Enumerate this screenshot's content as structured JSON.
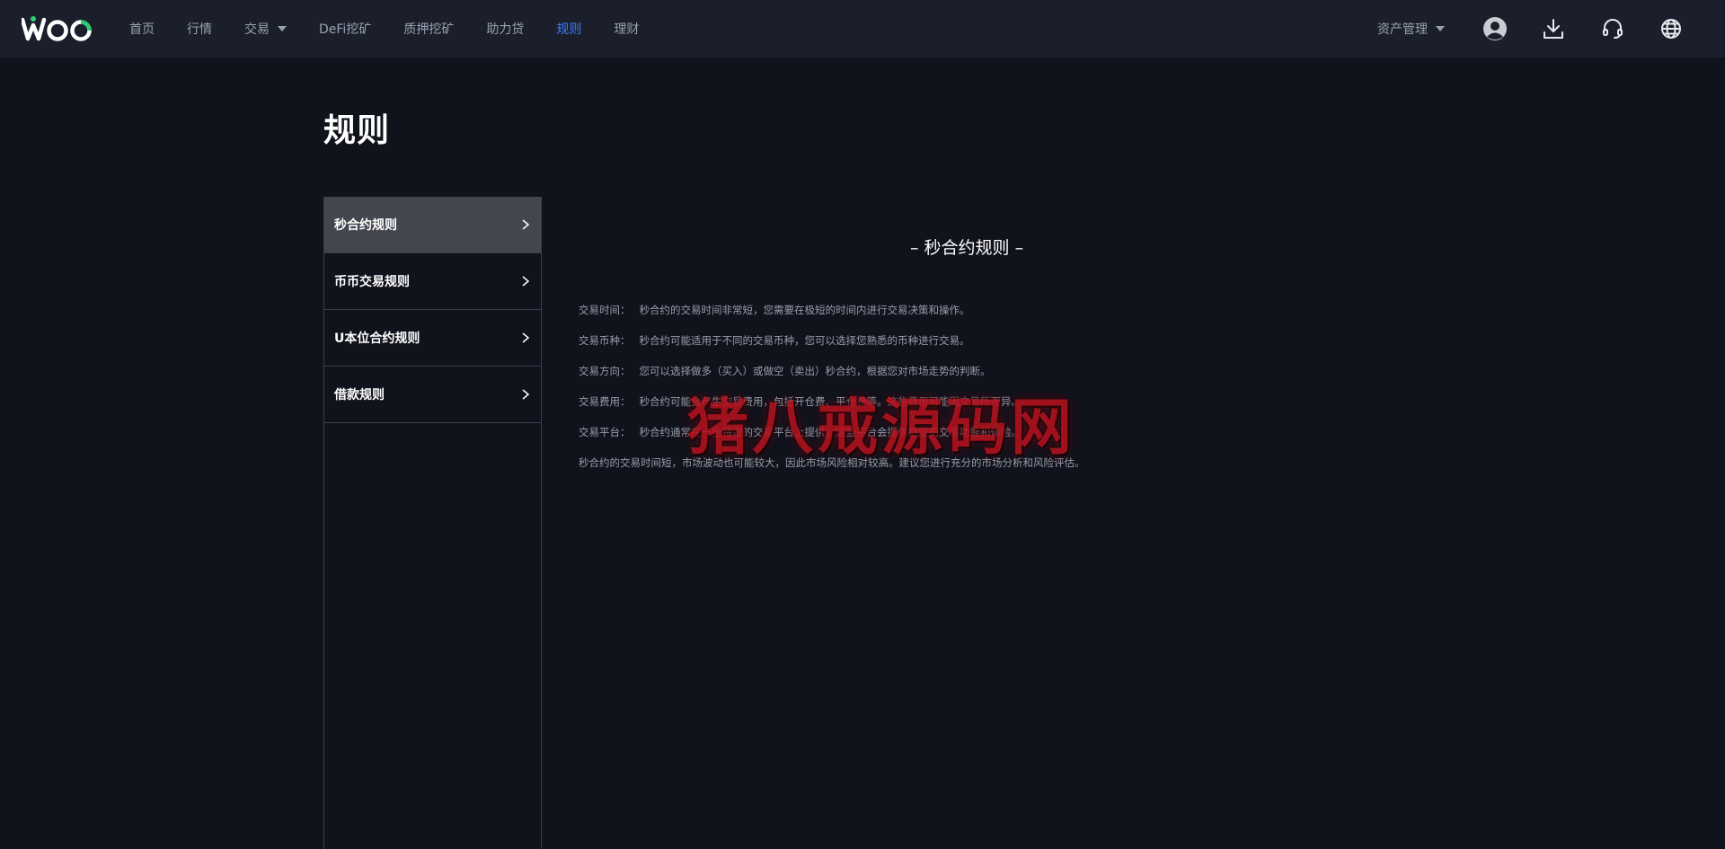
{
  "brand": {
    "name": "WOO",
    "accent": "#2ecc71"
  },
  "nav": {
    "items": [
      {
        "label": "首页"
      },
      {
        "label": "行情"
      },
      {
        "label": "交易"
      },
      {
        "label": "DeFi挖矿"
      },
      {
        "label": "质押挖矿"
      },
      {
        "label": "助力贷"
      },
      {
        "label": "规则"
      },
      {
        "label": "理财"
      }
    ],
    "active_color": "#3c7cff"
  },
  "header_right": {
    "asset_menu_label": "资产管理",
    "icons": [
      "user-avatar-icon",
      "download-icon",
      "headset-icon",
      "globe-icon"
    ]
  },
  "page": {
    "title": "规则"
  },
  "sidebar": {
    "items": [
      {
        "label": "秒合约规则"
      },
      {
        "label": "币币交易规则"
      },
      {
        "label": "U本位合约规则"
      },
      {
        "label": "借款规则"
      }
    ]
  },
  "content": {
    "section_title": "– 秒合约规则 –",
    "rules": [
      {
        "label": "交易时间：",
        "text": "秒合约的交易时间非常短，您需要在极短的时间内进行交易决策和操作。"
      },
      {
        "label": "交易币种：",
        "text": "秒合约可能适用于不同的交易币种，您可以选择您熟悉的币种进行交易。"
      },
      {
        "label": "交易方向：",
        "text": "您可以选择做多（买入）或做空（卖出）秒合约，根据您对市场走势的判断。"
      },
      {
        "label": "交易费用：",
        "text": "秒合约可能会产生交易费用，包括开仓费、平仓费等。这些费用可能因交易所而异。"
      },
      {
        "label": "交易平台：",
        "text": "秒合约通常在一些特定的交易平台上提供，这些平台会提供相应的交易功能和体验。"
      }
    ],
    "summary": "秒合约的交易时间短，市场波动也可能较大，因此市场风险相对较高。建议您进行充分的市场分析和风险评估。"
  },
  "watermark": {
    "text": "猪八戒源码网"
  }
}
